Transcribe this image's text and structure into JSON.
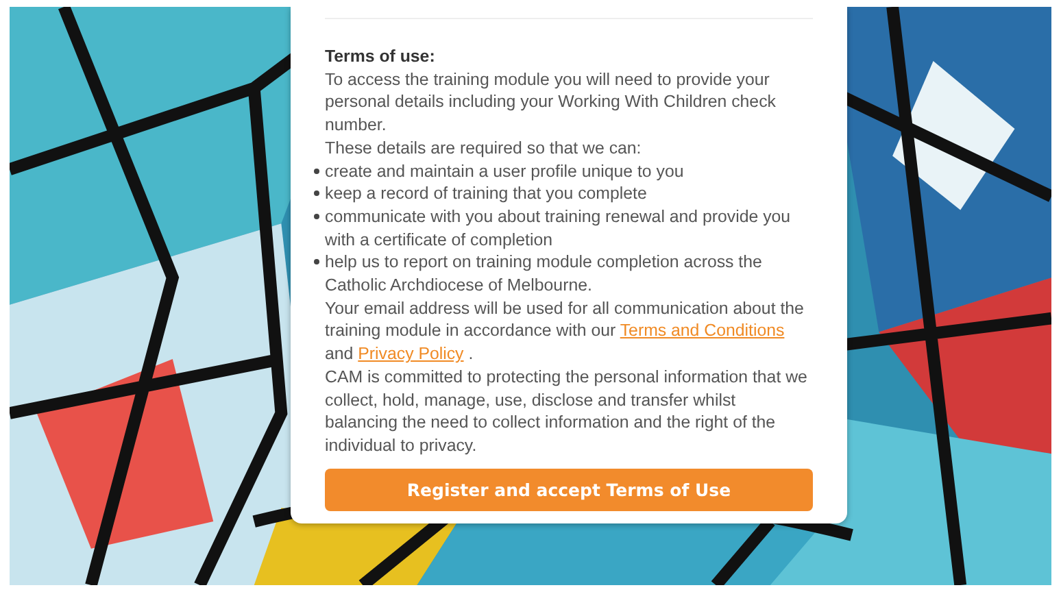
{
  "terms": {
    "title": "Terms of use:",
    "intro": "To access the training module you will need to provide your personal details including your Working With Children check number.",
    "lead": "These details are required so that we can:",
    "purposes": [
      "create and maintain a user profile unique to you",
      "keep a record of training that you complete",
      "communicate with you about training renewal and provide you with a certificate of completion",
      "help us to report on training module completion across the Catholic Archdiocese of Melbourne."
    ],
    "email_notice": [
      {
        "kind": "text",
        "text": "Your email address will be used for all communication about the training module in accordance with our"
      },
      {
        "kind": "link",
        "text": "Terms and Conditions"
      },
      {
        "kind": "text",
        "text": "and"
      },
      {
        "kind": "link",
        "text": "Privacy Policy"
      },
      {
        "kind": "text",
        "text": "."
      }
    ],
    "privacy_statement": "CAM is committed to protecting the personal information that we collect, hold, manage, use, disclose and transfer whilst balancing the need to collect information and the right of the individual to privacy."
  },
  "register_button": {
    "label": "Register and accept Terms of Use"
  }
}
